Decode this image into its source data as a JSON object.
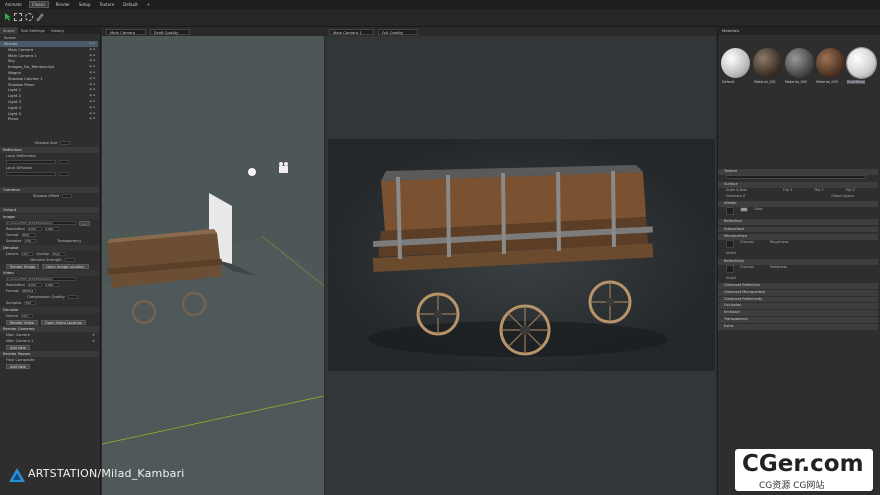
{
  "menu": [
    "Animate",
    "Classic",
    "Render",
    "Setup",
    "Texture",
    "Default",
    "+"
  ],
  "left_panel": {
    "tabs": [
      "Scene",
      "Tool Settings",
      "History"
    ],
    "tree_root": "Scene",
    "tree": [
      "Render",
      "Main Camera",
      "Main Camera 1",
      "Sky",
      "Images_For_Mentoscript",
      "Wagon",
      "Shadow Catcher 1",
      "Shadow Plane",
      "Light 1",
      "Light 2",
      "Light 3",
      "Light 4",
      "Light 5",
      "Plane"
    ],
    "sections": {
      "shadow_size": "Shadow Size",
      "reflection": "Reflection",
      "local_reflections": "Local Reflections",
      "local_diffusion": "Local Diffusion",
      "common": "Common",
      "shadow_offset": "Shadow Offset",
      "output": "Output",
      "image": "Image",
      "image_path": "C:/Users/FXM_Kt3456/Desktop",
      "resolution": "Resolution",
      "res_w": "1920",
      "res_h": "1080",
      "format": "Format",
      "format_value": "PNG",
      "samples": "Samples",
      "samples_value": "256",
      "transparency": "Transparency",
      "denoise": "Denoise",
      "device": "Device",
      "device_value": "CPU",
      "quality": "Quality",
      "quality_value": "High",
      "denoise_strength": "Denoise Strength",
      "render_image": "Render Image",
      "open_image_location": "Open Image Location",
      "video": "Video",
      "video_format": "MPEG4",
      "compression_quality": "Compression Quality",
      "render_video": "Render Video",
      "open_video_location": "Open Video Location",
      "render_cameras": "Render Cameras",
      "cameras": [
        "Main Camera",
        "Main Camera 1"
      ],
      "add_new": "Add New",
      "render_passes": "Render Passes",
      "final_composite": "Final Composite",
      "add_new_2": "Add New"
    }
  },
  "viewport_left": {
    "camera": "Main Camera",
    "quality": "Draft Quality"
  },
  "viewport_right": {
    "camera": "Main Camera 1",
    "quality": "Full Quality"
  },
  "right_panel": {
    "title": "Materials",
    "materials": [
      "Default",
      "Material_001",
      "Material_002",
      "Material_003",
      "Rust/Metal"
    ],
    "sections": [
      "Texture",
      "Surface",
      "Albedo",
      "Reflection",
      "Subsurface",
      "Microsurface",
      "Reflectivity",
      "Clearcoat Reflection",
      "Clearcoat Microsurface",
      "Clearcoat Reflectivity",
      "Occlusion",
      "Emission",
      "Transparency",
      "Extra"
    ],
    "rows": {
      "scale_bias": "Scale & Bias",
      "flip_x": "Flip X",
      "flip_y": "Flip Y",
      "flip_z": "Flip Z",
      "generate_z": "Generate Z",
      "object_space": "Object Space",
      "color": "Color",
      "roughness": "Roughness",
      "invert": "Invert",
      "metalness": "Metalness",
      "channel": "Channel"
    }
  },
  "watermark": "ARTSTATION/Milad_Kambari",
  "cger": {
    "big": "CGer.com",
    "small": "CG资源 CG网站"
  }
}
